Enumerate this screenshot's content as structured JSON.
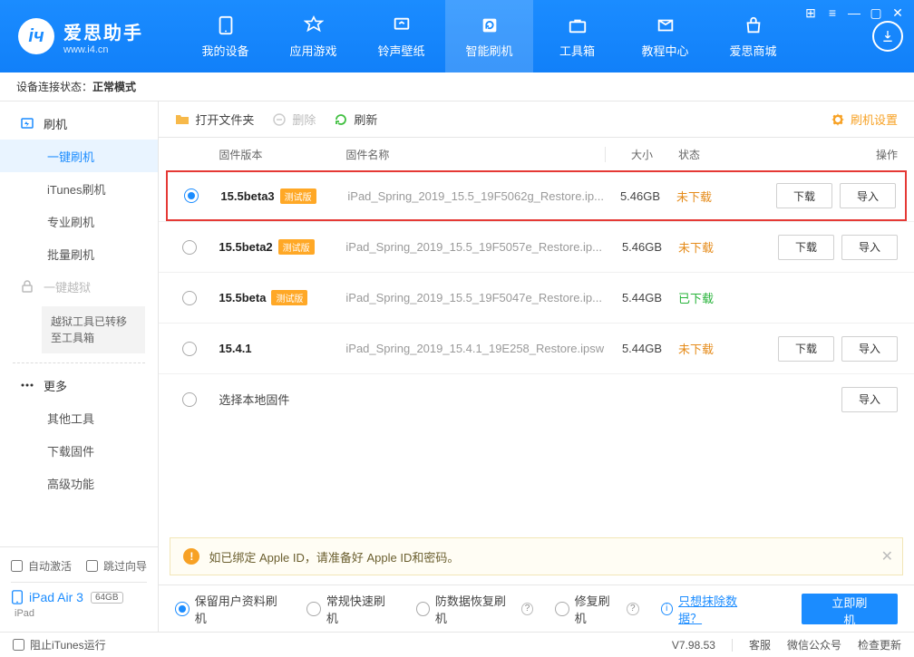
{
  "window_controls": [
    "grid",
    "menu",
    "min",
    "max",
    "close"
  ],
  "logo": {
    "title": "爱思助手",
    "subtitle": "www.i4.cn"
  },
  "nav": [
    {
      "key": "device",
      "label": "我的设备"
    },
    {
      "key": "apps",
      "label": "应用游戏"
    },
    {
      "key": "ring",
      "label": "铃声壁纸"
    },
    {
      "key": "flash",
      "label": "智能刷机",
      "active": true
    },
    {
      "key": "tool",
      "label": "工具箱"
    },
    {
      "key": "tutorial",
      "label": "教程中心"
    },
    {
      "key": "store",
      "label": "爱思商城"
    }
  ],
  "statusbar": {
    "label": "设备连接状态：",
    "value": "正常模式"
  },
  "sidebar": {
    "groups": [
      {
        "head": {
          "label": "刷机",
          "icon": "flash"
        },
        "items": [
          {
            "label": "一键刷机",
            "selected": true
          },
          {
            "label": "iTunes刷机"
          },
          {
            "label": "专业刷机"
          },
          {
            "label": "批量刷机"
          }
        ]
      },
      {
        "head": {
          "label": "一键越狱",
          "icon": "lock",
          "disabled": true
        },
        "note": "越狱工具已转移至工具箱"
      },
      {
        "sep": true,
        "head": {
          "label": "更多",
          "icon": "more"
        },
        "items": [
          {
            "label": "其他工具"
          },
          {
            "label": "下载固件"
          },
          {
            "label": "高级功能"
          }
        ]
      }
    ],
    "checks": {
      "auto_activate": "自动激活",
      "skip_guide": "跳过向导"
    },
    "device": {
      "name": "iPad Air 3",
      "capacity": "64GB",
      "type": "iPad"
    }
  },
  "toolbar": {
    "open": "打开文件夹",
    "delete": "删除",
    "refresh": "刷新",
    "settings": "刷机设置"
  },
  "table": {
    "head": {
      "ver": "固件版本",
      "name": "固件名称",
      "size": "大小",
      "status": "状态",
      "ops": "操作"
    },
    "btn_download": "下载",
    "btn_import": "导入",
    "rows": [
      {
        "selected": true,
        "highlight": true,
        "version": "15.5beta3",
        "badge": "测试版",
        "file": "iPad_Spring_2019_15.5_19F5062g_Restore.ip...",
        "size": "5.46GB",
        "status": "未下载",
        "status_kind": "none",
        "download": true,
        "import": true
      },
      {
        "version": "15.5beta2",
        "badge": "测试版",
        "file": "iPad_Spring_2019_15.5_19F5057e_Restore.ip...",
        "size": "5.46GB",
        "status": "未下载",
        "status_kind": "none",
        "download": true,
        "import": true
      },
      {
        "version": "15.5beta",
        "badge": "测试版",
        "file": "iPad_Spring_2019_15.5_19F5047e_Restore.ip...",
        "size": "5.44GB",
        "status": "已下载",
        "status_kind": "done",
        "download": false,
        "import": false
      },
      {
        "version": "15.4.1",
        "file": "iPad_Spring_2019_15.4.1_19E258_Restore.ipsw",
        "size": "5.44GB",
        "status": "未下载",
        "status_kind": "none",
        "download": true,
        "import": true
      },
      {
        "local": true,
        "version_label": "选择本地固件",
        "import": true
      }
    ]
  },
  "notice": {
    "text": "如已绑定 Apple ID，请准备好 Apple ID和密码。"
  },
  "flashbar": {
    "options": [
      {
        "label": "保留用户资料刷机",
        "selected": true
      },
      {
        "label": "常规快速刷机"
      },
      {
        "label": "防数据恢复刷机",
        "help": true
      },
      {
        "label": "修复刷机",
        "help": true
      }
    ],
    "erase_link": "只想抹除数据？",
    "go": "立即刷机"
  },
  "footer": {
    "block_itunes": "阻止iTunes运行",
    "version": "V7.98.53",
    "service": "客服",
    "wechat": "微信公众号",
    "update": "检查更新"
  }
}
